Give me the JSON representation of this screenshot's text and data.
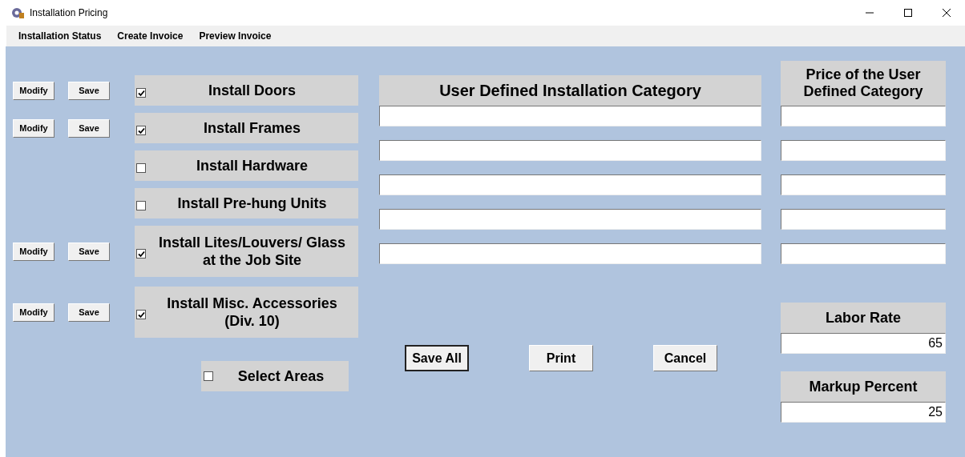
{
  "window": {
    "title": "Installation Pricing"
  },
  "menu": [
    "Installation Status",
    "Create Invoice",
    "Preview Invoice"
  ],
  "categories": [
    {
      "label": "Install Doors",
      "checked": true,
      "actions": [
        "Modify",
        "Save"
      ]
    },
    {
      "label": "Install Frames",
      "checked": true,
      "actions": [
        "Modify",
        "Save"
      ]
    },
    {
      "label": "Install Hardware",
      "checked": false
    },
    {
      "label": "Install Pre-hung Units",
      "checked": false
    },
    {
      "label": "Install Lites/Louvers/ Glass at the Job Site",
      "checked": true,
      "actions": [
        "Modify",
        "Save"
      ]
    },
    {
      "label": "Install Misc. Accessories (Div. 10)",
      "checked": true,
      "actions": [
        "Modify",
        "Save"
      ]
    }
  ],
  "select_areas": {
    "label": "Select Areas",
    "checked": false
  },
  "user_category": {
    "header": "User Defined Installation Category",
    "price_header": "Price of the User Defined Category"
  },
  "buttons": [
    {
      "label": "Save All",
      "default": true
    },
    {
      "label": "Print",
      "default": false
    },
    {
      "label": "Cancel",
      "default": false
    }
  ],
  "labor_rate": {
    "label": "Labor Rate",
    "value": "65"
  },
  "markup_percent": {
    "label": "Markup Percent",
    "value": "25"
  }
}
